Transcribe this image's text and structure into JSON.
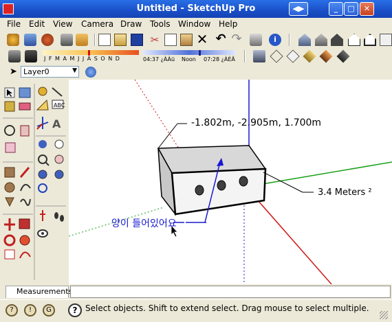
{
  "window": {
    "title": "Untitled - SketchUp Pro"
  },
  "menu": [
    "File",
    "Edit",
    "View",
    "Camera",
    "Draw",
    "Tools",
    "Window",
    "Help"
  ],
  "shadow": {
    "months": "J F M A M J J A S O N D",
    "time": "04:37 ¿ÀÀü",
    "noon": "Noon",
    "end_time": "07:28 ¿ÀÈÄ"
  },
  "layer": {
    "current": "Layer0"
  },
  "viewport": {
    "coord_label": "-1.802m, -2.905m, 1.700m",
    "area_label": "3.4 Meters ²",
    "annotation": "양이 들어있어요"
  },
  "measurements": {
    "label": "Measurements",
    "value": ""
  },
  "status": {
    "text": "Select objects. Shift to extend select. Drag mouse to select multiple."
  },
  "colors": {
    "titlebar": "#1a4fc8",
    "axis_blue": "#1818d0",
    "axis_red": "#d01818",
    "axis_green": "#18a018",
    "box_face": "#f4f4f4",
    "box_top": "#d8d8d8"
  }
}
